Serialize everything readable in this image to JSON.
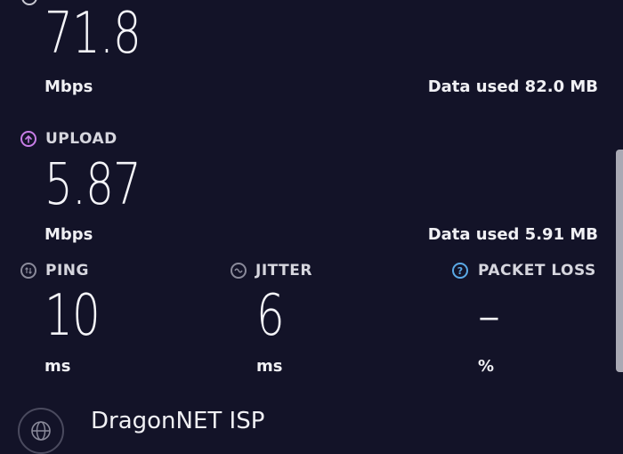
{
  "download": {
    "value": "71.8",
    "unit": "Mbps",
    "data_used": "Data used 82.0 MB"
  },
  "upload": {
    "label": "UPLOAD",
    "value": "5.87",
    "unit": "Mbps",
    "data_used": "Data used 5.91 MB",
    "icon": "upload-arrow-icon",
    "icon_color": "#c77de6"
  },
  "ping": {
    "label": "PING",
    "value": "10",
    "unit": "ms",
    "icon": "ping-icon"
  },
  "jitter": {
    "label": "JITTER",
    "value": "6",
    "unit": "ms",
    "icon": "jitter-wave-icon"
  },
  "packet_loss": {
    "label": "PACKET LOSS",
    "value": "–",
    "unit": "%",
    "icon": "help-question-icon",
    "icon_color": "#5aa9e6"
  },
  "isp": {
    "name": "DragonNET ISP",
    "icon": "globe-icon"
  },
  "colors": {
    "background": "#131328",
    "text": "#f0f0f4",
    "label": "#d6d6de"
  }
}
